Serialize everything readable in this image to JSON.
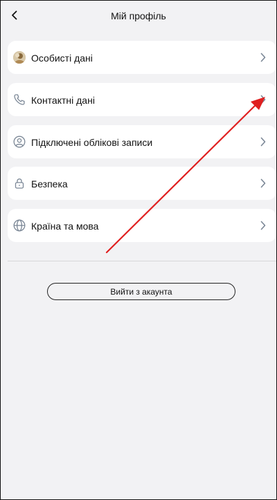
{
  "header": {
    "title": "Мій профіль"
  },
  "menu": {
    "items": [
      {
        "label": "Особисті дані",
        "icon": "avatar-photo"
      },
      {
        "label": "Контактні дані",
        "icon": "phone-icon"
      },
      {
        "label": "Підключені облікові записи",
        "icon": "user-circle-icon"
      },
      {
        "label": "Безпека",
        "icon": "lock-icon"
      },
      {
        "label": "Країна та мова",
        "icon": "globe-icon"
      }
    ]
  },
  "logout": {
    "label": "Вийти з акаунта"
  },
  "annotation": {
    "arrow_color": "#e02020"
  }
}
